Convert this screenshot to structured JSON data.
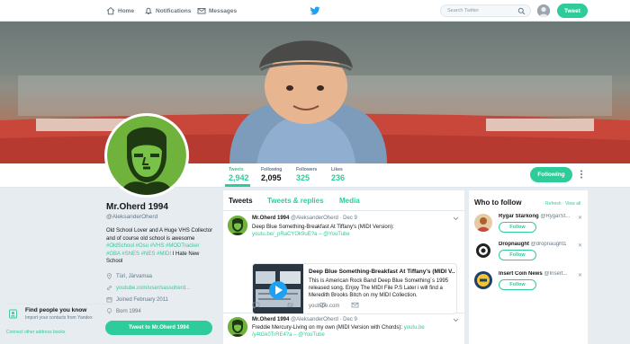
{
  "nav": {
    "home": "Home",
    "notifications": "Notifications",
    "messages": "Messages",
    "search_placeholder": "Search Twitter",
    "tweet_button": "Tweet"
  },
  "profile_stats": [
    {
      "label": "Tweets",
      "value": "2,942"
    },
    {
      "label": "Following",
      "value": "2,095"
    },
    {
      "label": "Followers",
      "value": "325"
    },
    {
      "label": "Likes",
      "value": "236"
    }
  ],
  "follow_button": "Following",
  "profile": {
    "name": "Mr.Oherd 1994",
    "handle": "@AleksanderOherd",
    "bio_text": "Old School Lover and A Huge VHS Collector and of course old school is awesome",
    "bio_tags": "#OldSchool #Osu #VHS #MODTracker #GBA #SNES #NES #MIDI",
    "bio_end": "I Hate New School",
    "location": "Türi, Järvamaa",
    "website": "youtube.com/user/sassoherd...",
    "joined": "Joined February 2011",
    "born": "Born 1994",
    "tweet_to": "Tweet to Mr.Oherd 1994"
  },
  "timeline": {
    "tabs": [
      "Tweets",
      "Tweets & replies",
      "Media"
    ],
    "tweets": [
      {
        "name": "Mr.Oherd 1994",
        "meta": "@AleksanderOherd · Dec 9",
        "text": "Deep Blue Something-Breakfast At Tiffany's (MIDI Version):",
        "link": "youtu.be/_pRaCYOk9uE?a",
        "via": "– @YouTube",
        "card_title": "Deep Blue Something-Breakfast At Tiffany's (MIDI V...",
        "card_desc": "This is American Rock Band Deep Blue Something´s 1995 released song. Enjoy The MIDI File P.S Later i will find a Meredith Brooks Bitch on my MIDI Collection.",
        "card_domain": "youtube.com"
      },
      {
        "name": "Mr.Oherd 1994",
        "meta": "@AleksanderOherd · Dec 9",
        "text": "Freddie Mercury-Living on my own (MIDI Version with Chords):",
        "link": "youtu.be /y4tGk0TrRE4?a",
        "via": "– @YouTube"
      }
    ]
  },
  "who_to_follow": {
    "title": "Who to follow",
    "refresh": "· Refresh",
    "view_all": "· View all",
    "follow_label": "Follow",
    "suggestions": [
      {
        "name": "Rygar Starkong",
        "handle": "@RygarSt..."
      },
      {
        "name": "Dropnaught",
        "handle": "@dropnaught1"
      },
      {
        "name": "Insert Coin News",
        "handle": "@Insert..."
      }
    ],
    "find_title": "Find people you know",
    "find_sub": "Import your contacts from Yandex",
    "connect": "Connect other address books"
  },
  "colors": {
    "accent": "#2ecc9a",
    "link_blue": "#1da1f2"
  }
}
